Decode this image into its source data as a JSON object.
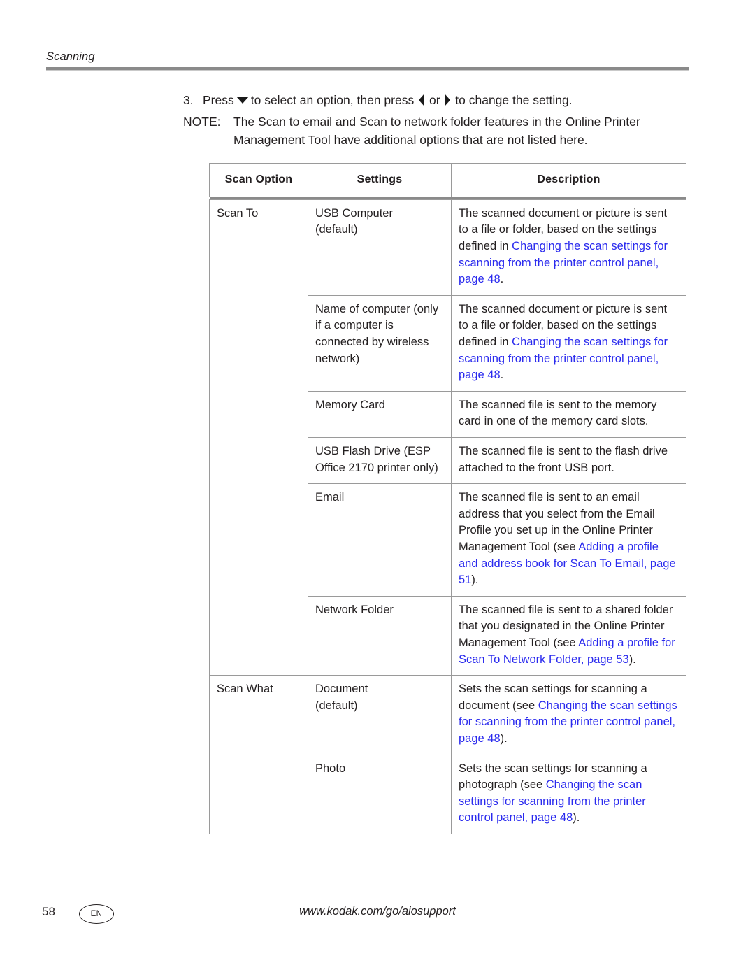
{
  "running_head": {
    "title": "Scanning"
  },
  "intro": {
    "step_number": "3.",
    "step_text_before_down": "Press",
    "step_text_after_down": "to select an option, then press",
    "step_text_or": "or",
    "step_text_end": "to change the setting.",
    "down_arrow_icon": "triangle-down-icon",
    "left_arrow_icon": "triangle-left-icon",
    "right_arrow_icon": "triangle-right-icon",
    "note_label": "NOTE:",
    "note_text": "The Scan to email and Scan to network folder features in the Online Printer Management Tool have additional options that are not listed here."
  },
  "table": {
    "headers": [
      "Scan Option",
      "Settings",
      "Description"
    ],
    "groups": [
      {
        "option": "Scan To",
        "rows": [
          {
            "setting": "USB Computer\n(default)",
            "desc_plain_1": "The scanned document or picture is sent to a file or folder, based on the settings defined in ",
            "desc_link": "Changing the scan settings for scanning from the printer control panel, page 48",
            "desc_plain_2": "."
          },
          {
            "setting": "Name of computer (only if a computer is connected by wireless network)",
            "desc_plain_1": "The scanned document or picture is sent to a file or folder, based on the settings defined in ",
            "desc_link": "Changing the scan settings for scanning from the printer control panel, page 48",
            "desc_plain_2": "."
          },
          {
            "setting": "Memory Card",
            "desc_plain_1": "The scanned file is sent to the memory card in one of the memory card slots.",
            "desc_link": "",
            "desc_plain_2": ""
          },
          {
            "setting": "USB Flash Drive (ESP Office 2170 printer only)",
            "desc_plain_1": "The scanned file is sent to the flash drive attached to the front USB port.",
            "desc_link": "",
            "desc_plain_2": ""
          },
          {
            "setting": "Email",
            "desc_plain_1": "The scanned file is sent to an email address that you select from the Email Profile you set up in the Online Printer Management Tool (see ",
            "desc_link": "Adding a profile and address book for Scan To Email, page 51",
            "desc_plain_2": ")."
          },
          {
            "setting": "Network Folder",
            "desc_plain_1": "The scanned file is sent to a shared folder that you designated in the Online Printer Management Tool (see ",
            "desc_link": "Adding a profile for Scan To Network Folder, page 53",
            "desc_plain_2": ")."
          }
        ]
      },
      {
        "option": "Scan What",
        "rows": [
          {
            "setting": "Document\n(default)",
            "desc_plain_1": "Sets the scan settings for scanning a document (see ",
            "desc_link": "Changing the scan settings for scanning from the printer control panel, page 48",
            "desc_plain_2": ")."
          },
          {
            "setting": "Photo",
            "desc_plain_1": "Sets the scan settings for scanning a photograph (see ",
            "desc_link": "Changing the scan settings for scanning from the printer control panel, page 48",
            "desc_plain_2": ")."
          }
        ]
      }
    ]
  },
  "footer": {
    "page_number": "58",
    "language_badge": "EN",
    "url": "www.kodak.com/go/aiosupport"
  },
  "colors": {
    "link": "#2a2aee",
    "text": "#231f20",
    "rule": "#8a8a8a",
    "border": "#9a9a9a"
  }
}
